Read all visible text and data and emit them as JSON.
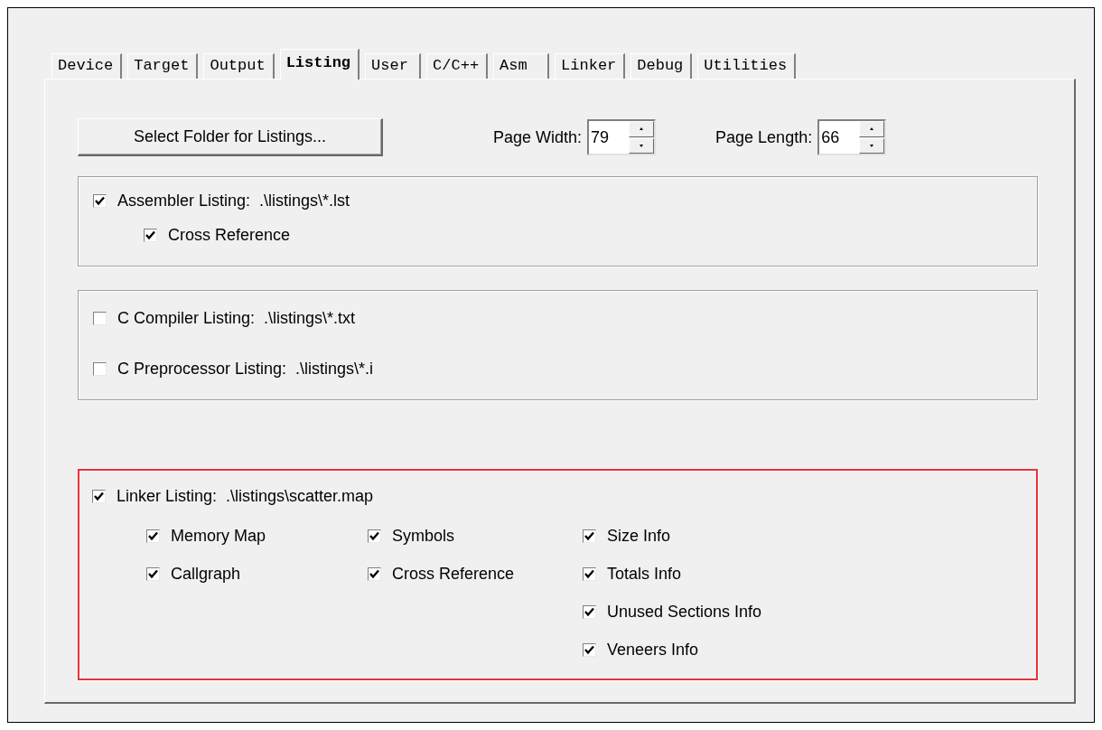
{
  "tabs": [
    {
      "label": "Device",
      "selected": false
    },
    {
      "label": "Target",
      "selected": false
    },
    {
      "label": "Output",
      "selected": false
    },
    {
      "label": "Listing",
      "selected": true
    },
    {
      "label": "User",
      "selected": false
    },
    {
      "label": "C/C++",
      "selected": false
    },
    {
      "label": "Asm",
      "selected": false
    },
    {
      "label": "Linker",
      "selected": false
    },
    {
      "label": "Debug",
      "selected": false
    },
    {
      "label": "Utilities",
      "selected": false
    }
  ],
  "folder_button": "Select Folder for Listings...",
  "page_width": {
    "label": "Page Width:",
    "value": "79"
  },
  "page_length": {
    "label": "Page Length:",
    "value": "66"
  },
  "groups": [
    {
      "kind": "nested",
      "highlighted": false,
      "options": [
        {
          "label": "Assembler Listing:  .\\listings\\*.lst",
          "checked": true,
          "children": [
            {
              "label": "Cross Reference",
              "checked": true
            }
          ]
        }
      ]
    },
    {
      "kind": "spaced",
      "highlighted": false,
      "options": [
        {
          "label": "C Compiler Listing:  .\\listings\\*.txt",
          "checked": false
        },
        {
          "label": "C Preprocessor Listing:  .\\listings\\*.i",
          "checked": false
        }
      ]
    },
    {
      "kind": "columns",
      "highlighted": true,
      "options": [
        {
          "label": "Linker Listing:  .\\listings\\scatter.map",
          "checked": true,
          "columns": [
            [
              {
                "label": "Memory Map",
                "checked": true
              },
              {
                "label": "Callgraph",
                "checked": true
              }
            ],
            [
              {
                "label": "Symbols",
                "checked": true
              },
              {
                "label": "Cross Reference",
                "checked": true
              }
            ],
            [
              {
                "label": "Size Info",
                "checked": true
              },
              {
                "label": "Totals Info",
                "checked": true
              },
              {
                "label": "Unused Sections Info",
                "checked": true
              },
              {
                "label": "Veneers Info",
                "checked": true
              }
            ]
          ]
        }
      ]
    }
  ]
}
